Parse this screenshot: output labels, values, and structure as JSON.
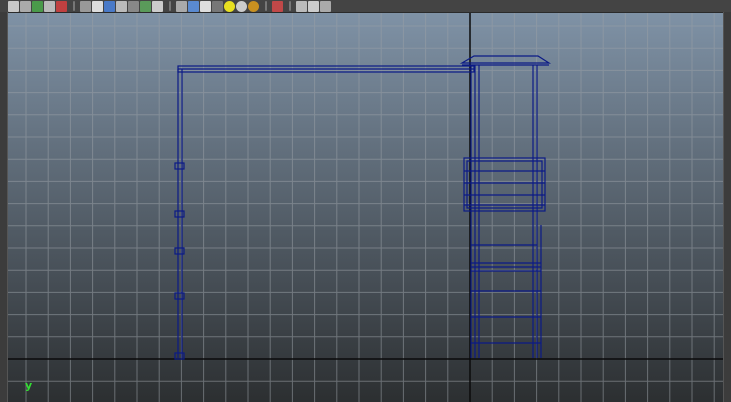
{
  "app": {
    "axis_label": "y"
  },
  "toolbar": {
    "icons": [
      "select-icon",
      "lasso-icon",
      "paint-icon",
      "shelf-icon",
      "snap-icon",
      "wireframe-icon",
      "smooth-shade-icon",
      "sphere-shade-icon",
      "flat-shade-icon",
      "xray-icon",
      "grid-toggle-icon",
      "info-icon",
      "cube-wire-icon",
      "cube-shade-icon",
      "cube-texture-icon",
      "checker-icon",
      "light-yellow-icon",
      "light-grey-icon",
      "light-gold-icon",
      "pick-mask-icon",
      "camera-icon",
      "bookmark-icon",
      "link-icon"
    ]
  },
  "colors": {
    "viewport_top": "#7f92a6",
    "viewport_bottom": "#2c2f31",
    "grid": "#9aa0a6",
    "axis_line": "#0b0b0b",
    "wireframe": "#0b1a86"
  }
}
